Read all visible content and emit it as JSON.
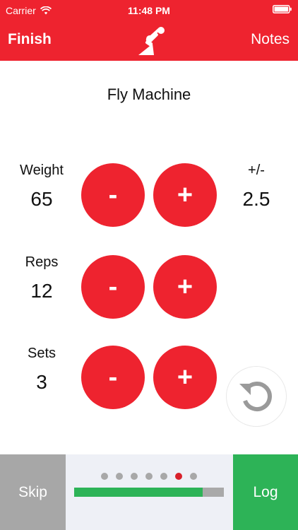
{
  "status_bar": {
    "carrier": "Carrier",
    "time": "11:48 PM"
  },
  "header": {
    "left_label": "Finish",
    "right_label": "Notes",
    "logo_icon": "lifter-logo-icon"
  },
  "exercise": {
    "name": "Fly Machine"
  },
  "rows": {
    "weight": {
      "label": "Weight",
      "value": "65",
      "minus": "-",
      "plus": "+"
    },
    "reps": {
      "label": "Reps",
      "value": "12",
      "minus": "-",
      "plus": "+"
    },
    "sets": {
      "label": "Sets",
      "value": "3",
      "minus": "-",
      "plus": "+"
    }
  },
  "increment": {
    "label": "+/-",
    "value": "2.5"
  },
  "bottom": {
    "skip_label": "Skip",
    "log_label": "Log",
    "dots_total": 7,
    "dots_active_index": 5,
    "progress_fraction": 0.86
  },
  "colors": {
    "accent_red": "#ee232f",
    "log_green": "#2db357",
    "skip_gray": "#a7a7a7"
  }
}
